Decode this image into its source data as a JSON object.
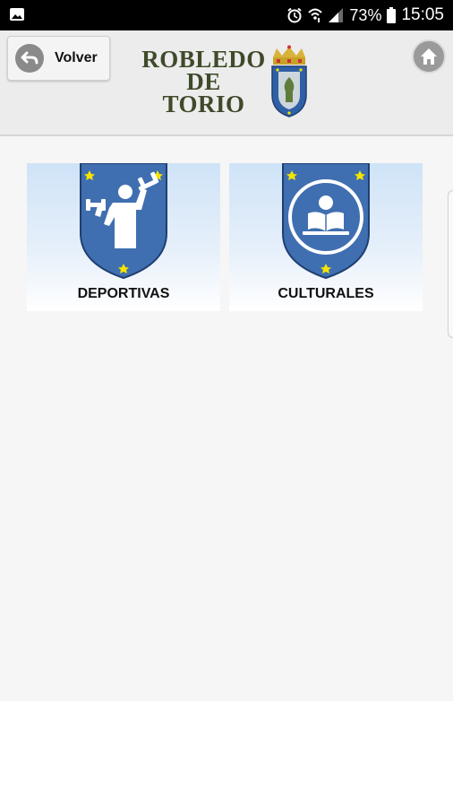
{
  "status_bar": {
    "battery": "73%",
    "time": "15:05",
    "icons": [
      "image-notification-icon",
      "alarm-icon",
      "wifi-icon",
      "signal-icon",
      "battery-icon"
    ]
  },
  "header": {
    "back_label": "Volver",
    "logo_line1": "ROBLEDO",
    "logo_line2": "DE",
    "logo_line3": "TORIO",
    "home_icon": "home-icon"
  },
  "tiles": [
    {
      "label": "DEPORTIVAS",
      "icon": "weightlifter-icon"
    },
    {
      "label": "CULTURALES",
      "icon": "reader-icon"
    }
  ],
  "colors": {
    "shield_blue": "#3f6fb0",
    "star_yellow": "#f5e400",
    "header_bg": "#ececec",
    "logo_text": "#3f4a2a"
  }
}
